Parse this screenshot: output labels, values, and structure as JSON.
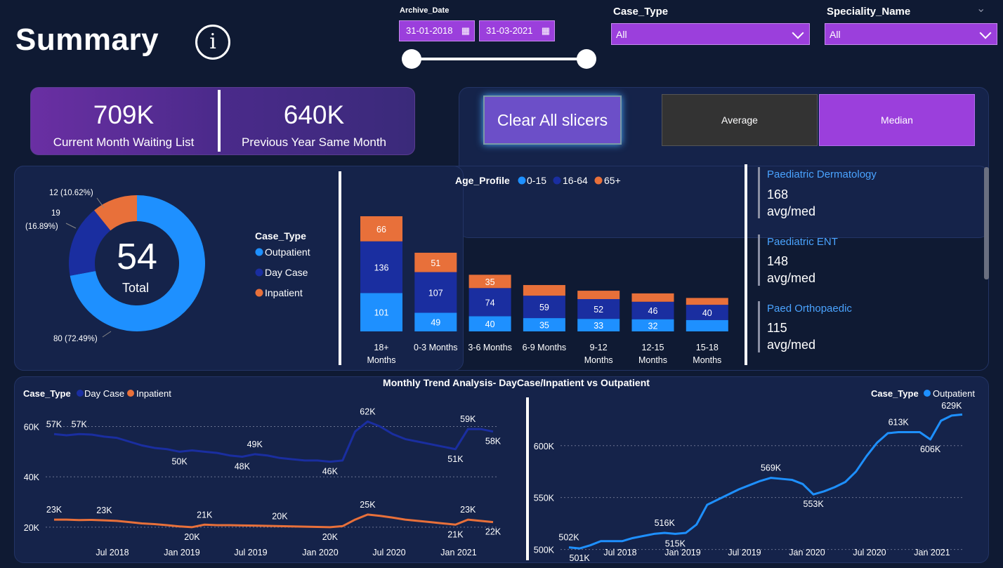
{
  "header": {
    "title": "Summary",
    "info_symbol": "i",
    "archive_date_label": "Archive_Date",
    "start_date": "31-01-2018",
    "end_date": "31-03-2021",
    "case_type_label": "Case_Type",
    "case_type_value": "All",
    "speciality_label": "Speciality_Name",
    "speciality_value": "All",
    "calendar_glyph": "▦",
    "collapse_glyph": "⌄"
  },
  "kpis": [
    {
      "value": "709K",
      "label": "Current Month Waiting List"
    },
    {
      "value": "640K",
      "label": "Previous Year Same Month"
    }
  ],
  "buttons": {
    "clear": "Clear All slicers",
    "average": "Average",
    "median": "Median"
  },
  "specialities": [
    {
      "name": "Paediatric Dermatology",
      "value": "168",
      "unit": "avg/med"
    },
    {
      "name": "Paediatric ENT",
      "value": "148",
      "unit": "avg/med"
    },
    {
      "name": "Paed Orthopaedic",
      "value": "115",
      "unit": "avg/med"
    }
  ],
  "colors": {
    "outpatient": "#1e90ff",
    "daycase": "#1a2ea0",
    "inpatient": "#e8703a",
    "accent": "#9b3fdc",
    "age_0_15": "#1e90ff",
    "age_16_64": "#1a2ea0",
    "age_65": "#e8703a"
  },
  "chart_data": [
    {
      "type": "pie",
      "title": "",
      "center_value": "54",
      "center_label": "Total",
      "legend_title": "Case_Type",
      "slices": [
        {
          "name": "Outpatient",
          "value": 80,
          "label": "80 (72.49%)"
        },
        {
          "name": "Day Case",
          "value": 19,
          "label_a": "19",
          "label_b": "(16.89%)"
        },
        {
          "name": "Inpatient",
          "value": 12,
          "label": "12 (10.62%)"
        }
      ]
    },
    {
      "type": "bar",
      "legend_title": "Age_Profile",
      "categories": [
        "18+ Months",
        "0-3 Months",
        "3-6 Months",
        "6-9 Months",
        "9-12 Months",
        "12-15 Months",
        "15-18 Months"
      ],
      "category_lines": [
        [
          "18+",
          "Months"
        ],
        [
          "0-3 Months"
        ],
        [
          "3-6 Months"
        ],
        [
          "6-9 Months"
        ],
        [
          "9-12",
          "Months"
        ],
        [
          "12-15",
          "Months"
        ],
        [
          "15-18",
          "Months"
        ]
      ],
      "series": [
        {
          "name": "0-15",
          "values": [
            101,
            49,
            40,
            35,
            33,
            32,
            30
          ],
          "labels": [
            "101",
            "49",
            "40",
            "35",
            "33",
            "32",
            ""
          ]
        },
        {
          "name": "16-64",
          "values": [
            136,
            107,
            74,
            59,
            52,
            46,
            40
          ],
          "labels": [
            "136",
            "107",
            "74",
            "59",
            "52",
            "46",
            "40"
          ]
        },
        {
          "name": "65+",
          "values": [
            66,
            51,
            35,
            28,
            22,
            22,
            18
          ],
          "labels": [
            "66",
            "51",
            "35",
            "",
            "",
            "",
            ""
          ]
        }
      ]
    },
    {
      "type": "line",
      "title": "Monthly Trend Analysis- DayCase/Inpatient vs Outpatient",
      "legend_title": "Case_Type",
      "x_ticks": [
        "Jul 2018",
        "Jan 2019",
        "Jul 2019",
        "Jan 2020",
        "Jul 2020",
        "Jan 2021"
      ],
      "y_ticks": [
        "60K",
        "40K",
        "20K"
      ],
      "ylim": [
        18000,
        66000
      ],
      "series": [
        {
          "name": "Day Case",
          "values": [
            57000,
            56500,
            57000,
            56800,
            56000,
            55500,
            54000,
            52500,
            51500,
            51000,
            50000,
            50500,
            50000,
            49500,
            48500,
            48000,
            49000,
            48500,
            47500,
            47000,
            46500,
            46500,
            46000,
            46500,
            58000,
            62000,
            60000,
            57000,
            55000,
            54000,
            53000,
            52000,
            51000,
            59000,
            59000,
            58000
          ]
        },
        {
          "name": "Inpatient",
          "values": [
            23000,
            23000,
            22800,
            22900,
            22700,
            22500,
            22000,
            21500,
            21200,
            20800,
            20300,
            20000,
            21000,
            20800,
            20800,
            20700,
            20600,
            20500,
            20400,
            20300,
            20200,
            20100,
            20000,
            20400,
            23000,
            25000,
            24500,
            23800,
            23000,
            22500,
            22000,
            21500,
            21000,
            23000,
            22500,
            22000
          ]
        }
      ],
      "point_labels": [
        {
          "s": 0,
          "i": 0,
          "t": "57K"
        },
        {
          "s": 0,
          "i": 2,
          "t": "57K"
        },
        {
          "s": 0,
          "i": 10,
          "t": "50K"
        },
        {
          "s": 0,
          "i": 15,
          "t": "48K"
        },
        {
          "s": 0,
          "i": 16,
          "t": "49K"
        },
        {
          "s": 0,
          "i": 22,
          "t": "46K"
        },
        {
          "s": 0,
          "i": 25,
          "t": "62K"
        },
        {
          "s": 0,
          "i": 32,
          "t": "51K"
        },
        {
          "s": 0,
          "i": 33,
          "t": "59K"
        },
        {
          "s": 0,
          "i": 35,
          "t": "58K"
        },
        {
          "s": 1,
          "i": 0,
          "t": "23K"
        },
        {
          "s": 1,
          "i": 4,
          "t": "23K"
        },
        {
          "s": 1,
          "i": 11,
          "t": "20K"
        },
        {
          "s": 1,
          "i": 12,
          "t": "21K"
        },
        {
          "s": 1,
          "i": 18,
          "t": "20K"
        },
        {
          "s": 1,
          "i": 22,
          "t": "20K"
        },
        {
          "s": 1,
          "i": 25,
          "t": "25K"
        },
        {
          "s": 1,
          "i": 32,
          "t": "21K"
        },
        {
          "s": 1,
          "i": 33,
          "t": "23K"
        },
        {
          "s": 1,
          "i": 35,
          "t": "22K"
        }
      ]
    },
    {
      "type": "line",
      "legend_title": "Case_Type",
      "x_ticks": [
        "Jul 2018",
        "Jan 2019",
        "Jul 2019",
        "Jan 2020",
        "Jul 2020",
        "Jan 2021"
      ],
      "y_ticks": [
        "600K",
        "550K",
        "500K"
      ],
      "ylim": [
        495000,
        635000
      ],
      "series": [
        {
          "name": "Outpatient",
          "values": [
            502000,
            501000,
            504000,
            508000,
            508000,
            508000,
            511000,
            513000,
            515000,
            516000,
            515000,
            516000,
            524000,
            543000,
            548000,
            553000,
            558000,
            562000,
            566000,
            569000,
            568000,
            567000,
            563000,
            553000,
            556000,
            560000,
            565000,
            575000,
            590000,
            603000,
            612000,
            613000,
            613000,
            613000,
            606000,
            624000,
            629000,
            630000
          ]
        }
      ],
      "point_labels": [
        {
          "s": 0,
          "i": 0,
          "t": "502K"
        },
        {
          "s": 0,
          "i": 1,
          "t": "501K"
        },
        {
          "s": 0,
          "i": 9,
          "t": "516K"
        },
        {
          "s": 0,
          "i": 10,
          "t": "515K"
        },
        {
          "s": 0,
          "i": 19,
          "t": "569K"
        },
        {
          "s": 0,
          "i": 23,
          "t": "553K"
        },
        {
          "s": 0,
          "i": 31,
          "t": "613K"
        },
        {
          "s": 0,
          "i": 34,
          "t": "606K"
        },
        {
          "s": 0,
          "i": 36,
          "t": "629K"
        }
      ]
    }
  ]
}
